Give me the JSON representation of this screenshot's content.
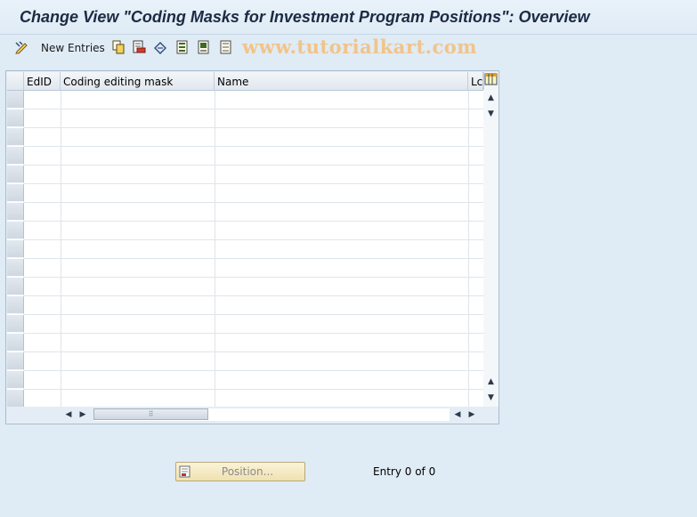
{
  "window": {
    "title": "Change View \"Coding Masks for Investment Program Positions\": Overview"
  },
  "toolbar": {
    "new_entries_label": "New Entries",
    "watermark": "www.tutorialkart.com",
    "icons": [
      "change-display-icon",
      "copy-icon",
      "delete-icon",
      "undo-change-icon",
      "select-all-icon",
      "select-block-icon",
      "deselect-all-icon"
    ]
  },
  "table": {
    "columns": [
      {
        "label": "EdID"
      },
      {
        "label": "Coding editing mask"
      },
      {
        "label": "Name"
      },
      {
        "label": "Lcl"
      }
    ],
    "row_count": 17,
    "rows": []
  },
  "footer": {
    "position_button_label": "Position...",
    "entry_status": "Entry 0 of 0"
  }
}
